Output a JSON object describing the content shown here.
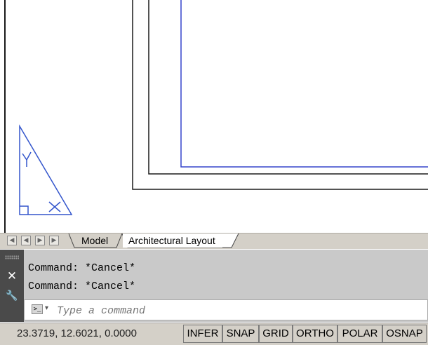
{
  "layout_tabs": {
    "model_label": "Model",
    "active_label": "Architectural Layout"
  },
  "command_line": {
    "history": [
      "Command: *Cancel*",
      "Command: *Cancel*"
    ],
    "placeholder": "Type a command",
    "prompt_glyph": ">_",
    "prompt_arrow": "▾",
    "close_glyph": "✕",
    "customize_glyph": "🔧"
  },
  "status_bar": {
    "coordinates": "23.3719, 12.6021, 0.0000",
    "toggles": [
      "INFER",
      "SNAP",
      "GRID",
      "ORTHO",
      "POLAR",
      "OSNAP"
    ]
  },
  "colors": {
    "viewport_border": "#3344cc",
    "ucs_icon": "#3355cc",
    "paper_edge": "#1a1a1a"
  }
}
